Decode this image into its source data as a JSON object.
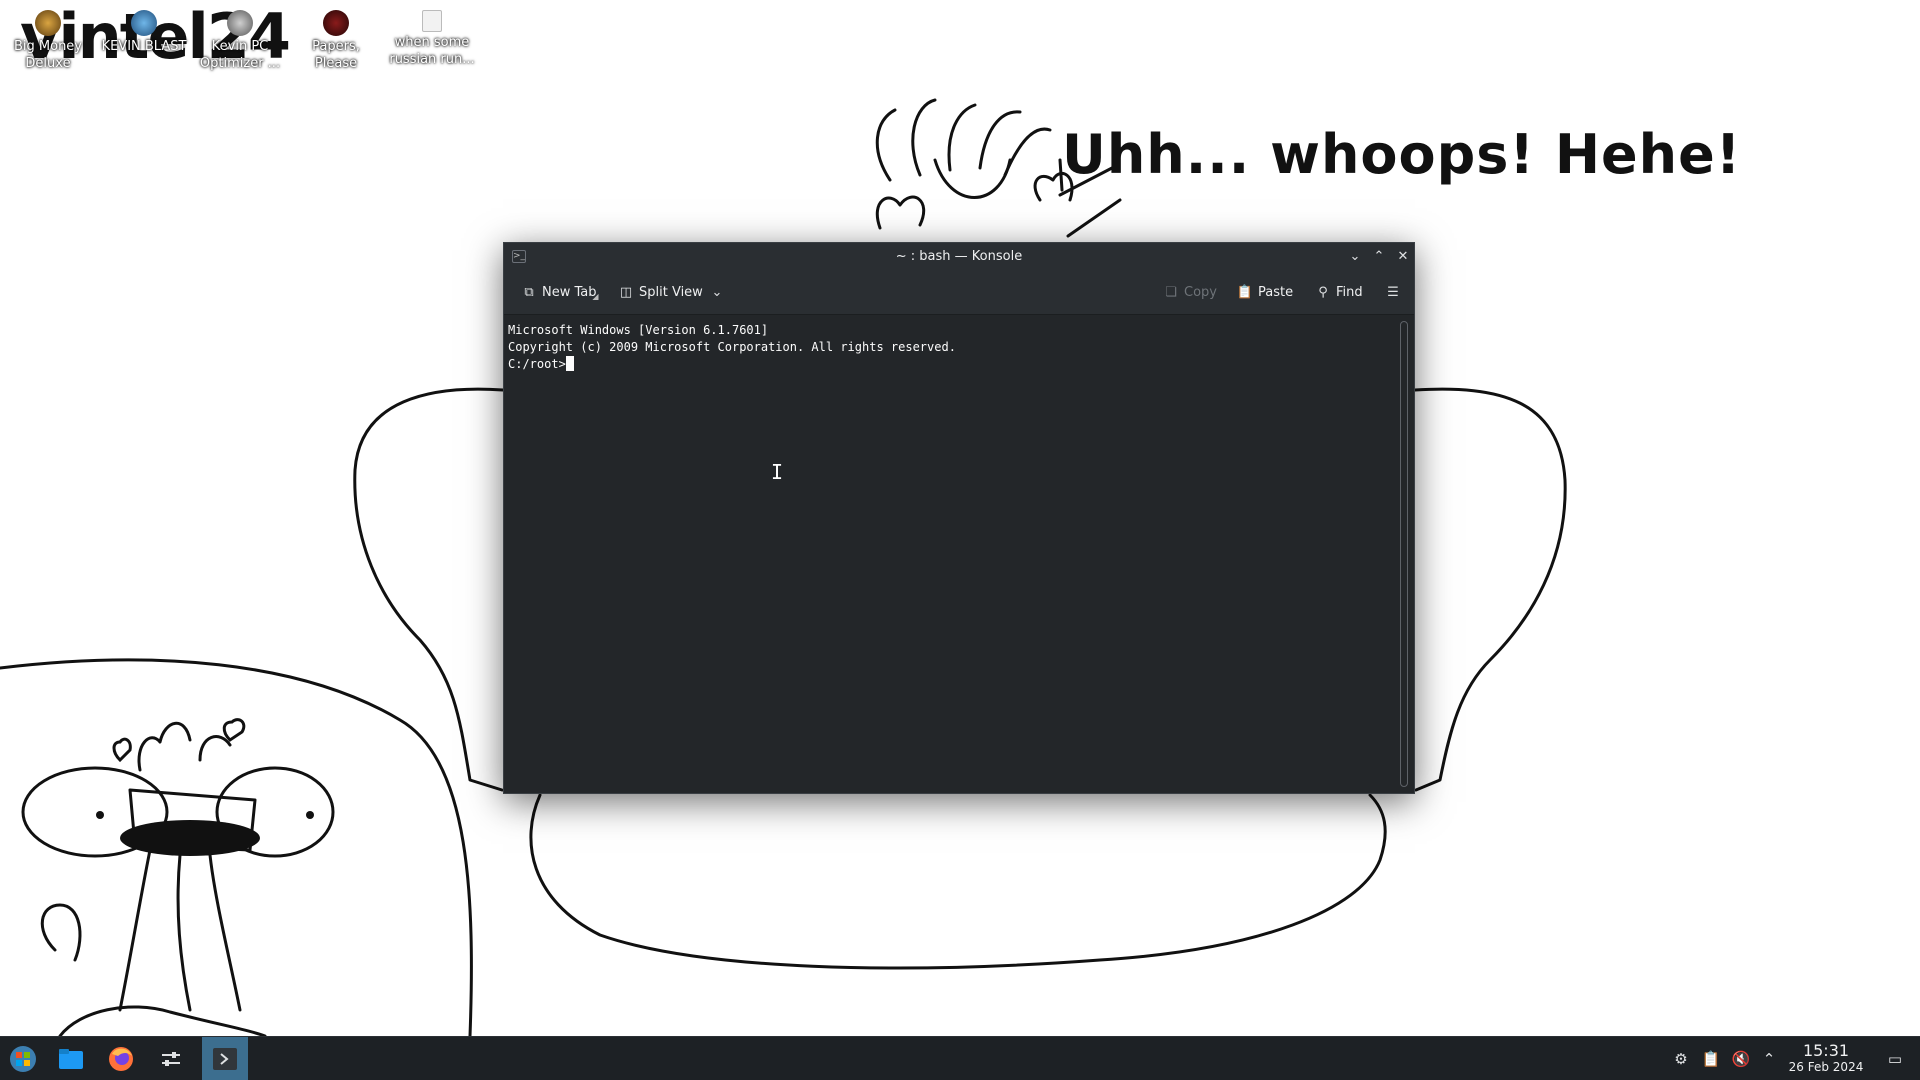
{
  "wallpaper": {
    "logo_text": "vintel24",
    "caption": "Uhh... whoops! Hehe!"
  },
  "desktop": {
    "icons": [
      {
        "name": "Big Money Deluxe",
        "line1": "Big Money",
        "line2": "Deluxe"
      },
      {
        "name": "KEVIN BLAST",
        "line1": "KEVIN BLAST",
        "line2": ""
      },
      {
        "name": "Kevin PC Optimizer",
        "line1": "Kevin PC",
        "line2": "Optimizer ..."
      },
      {
        "name": "Papers, Please",
        "line1": "Papers,",
        "line2": "Please"
      },
      {
        "name": "when some russian run...",
        "line1": "when some",
        "line2": "russian run..."
      }
    ]
  },
  "window": {
    "app_icon": "terminal-icon",
    "title": "~ : bash — Konsole",
    "controls": {
      "minimize": "chevron-down-icon",
      "maximize": "chevron-up-icon",
      "close": "close-icon"
    },
    "toolbar": {
      "new_tab_label": "New Tab",
      "split_view_label": "Split View",
      "copy_label": "Copy",
      "paste_label": "Paste",
      "find_label": "Find"
    },
    "terminal": {
      "lines": [
        "Microsoft Windows [Version 6.1.7601]",
        "Copyright (c) 2009 Microsoft Corporation. All rights reserved.",
        "",
        "C:/root>"
      ]
    }
  },
  "taskbar": {
    "apps": [
      "start-menu-icon",
      "file-manager-icon",
      "firefox-icon",
      "settings-icon",
      "konsole-icon"
    ],
    "tray": [
      "updates-icon",
      "clipboard-icon",
      "volume-muted-icon",
      "tray-expand-icon"
    ],
    "clock": {
      "time": "15:31",
      "date": "26 Feb 2024"
    },
    "show_desktop": "show-desktop-icon"
  },
  "colors": {
    "window_bg": "#232629",
    "titlebar_bg": "#2a2e32",
    "taskbar_bg": "#1d2125",
    "active_task": "#3c6e8f"
  }
}
